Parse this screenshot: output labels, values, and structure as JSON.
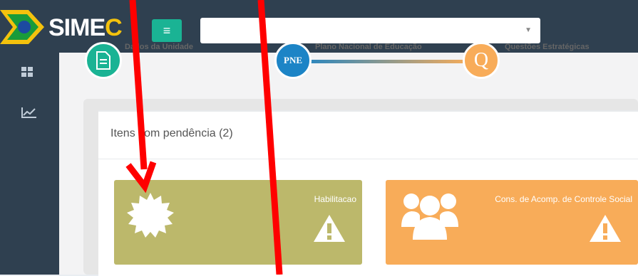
{
  "header": {
    "logo_part1": "SIME",
    "logo_part2": "C",
    "menu_icon": "hamburger-icon",
    "select_value": ""
  },
  "sidebar": {
    "items": [
      {
        "icon": "dashboard-grid-icon"
      },
      {
        "icon": "line-chart-icon"
      }
    ]
  },
  "steps": [
    {
      "label": "Dados da Unidade",
      "badge": "",
      "color": "#1ab394"
    },
    {
      "label": "Plano Nacional de Educação",
      "badge": "PNE",
      "color": "#1c84c6"
    },
    {
      "label": "Questões Estratégicas",
      "badge": "Q",
      "color": "#f8ac59"
    }
  ],
  "panel": {
    "title": "Itens com pendência (2)"
  },
  "tiles": [
    {
      "title": "Habilitacao",
      "icon": "badge-seal-icon",
      "color": "#bcb86b"
    },
    {
      "title": "Cons. de Acomp. de Controle Social",
      "icon": "users-group-icon",
      "color": "#f8ac59"
    }
  ]
}
